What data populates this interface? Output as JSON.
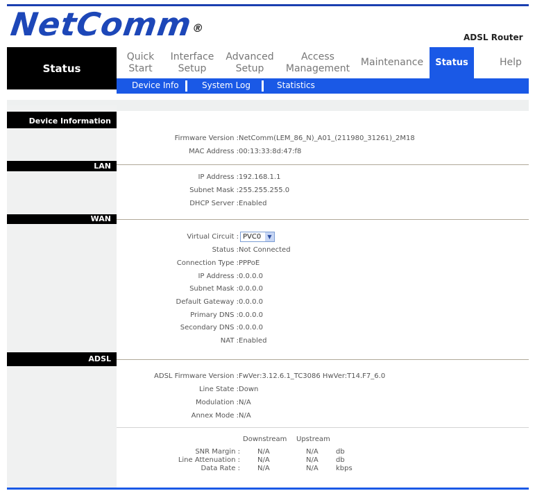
{
  "brand": {
    "logo": "NetComm",
    "reg": "®",
    "product": "ADSL Router"
  },
  "nav": {
    "section_title": "Status",
    "items": [
      {
        "label": "Quick\nStart"
      },
      {
        "label": "Interface\nSetup"
      },
      {
        "label": "Advanced\nSetup"
      },
      {
        "label": "Access\nManagement"
      },
      {
        "label": "Maintenance"
      },
      {
        "label": "Status"
      },
      {
        "label": "Help"
      }
    ],
    "subnav": [
      "Device Info",
      "System Log",
      "Statistics"
    ]
  },
  "sections": {
    "device": {
      "title": "Device Information",
      "firmware_label": "Firmware Version :",
      "firmware_value": "NetComm(LEM_86_N)_A01_(211980_31261)_2M18",
      "mac_label": "MAC Address :",
      "mac_value": "00:13:33:8d:47:f8"
    },
    "lan": {
      "title": "LAN",
      "ip_label": "IP Address :",
      "ip_value": "192.168.1.1",
      "mask_label": "Subnet Mask :",
      "mask_value": "255.255.255.0",
      "dhcp_label": "DHCP Server :",
      "dhcp_value": "Enabled"
    },
    "wan": {
      "title": "WAN",
      "vc_label": "Virtual Circuit :",
      "vc_value": "PVC0",
      "status_label": "Status :",
      "status_value": "Not Connected",
      "conn_label": "Connection Type :",
      "conn_value": "PPPoE",
      "ip_label": "IP Address :",
      "ip_value": "0.0.0.0",
      "mask_label": "Subnet Mask :",
      "mask_value": "0.0.0.0",
      "gw_label": "Default Gateway :",
      "gw_value": "0.0.0.0",
      "pdns_label": "Primary DNS :",
      "pdns_value": "0.0.0.0",
      "sdns_label": "Secondary DNS :",
      "sdns_value": "0.0.0.0",
      "nat_label": "NAT :",
      "nat_value": "Enabled"
    },
    "adsl": {
      "title": "ADSL",
      "fw_label": "ADSL Firmware Version :",
      "fw_value": "FwVer:3.12.6.1_TC3086 HwVer:T14.F7_6.0",
      "line_label": "Line State :",
      "line_value": "Down",
      "mod_label": "Modulation :",
      "mod_value": "N/A",
      "annex_label": "Annex Mode :",
      "annex_value": "N/A",
      "col_down": "Downstream",
      "col_up": "Upstream",
      "snr_label": "SNR Margin :",
      "snr_down": "N/A",
      "snr_up": "N/A",
      "snr_unit": "db",
      "att_label": "Line Attenuation :",
      "att_down": "N/A",
      "att_up": "N/A",
      "att_unit": "db",
      "rate_label": "Data Rate :",
      "rate_down": "N/A",
      "rate_up": "N/A",
      "rate_unit": "kbps"
    }
  },
  "colors": {
    "accent": "#1a59e6",
    "logo": "#1d47b8",
    "header_bg": "#000000"
  }
}
